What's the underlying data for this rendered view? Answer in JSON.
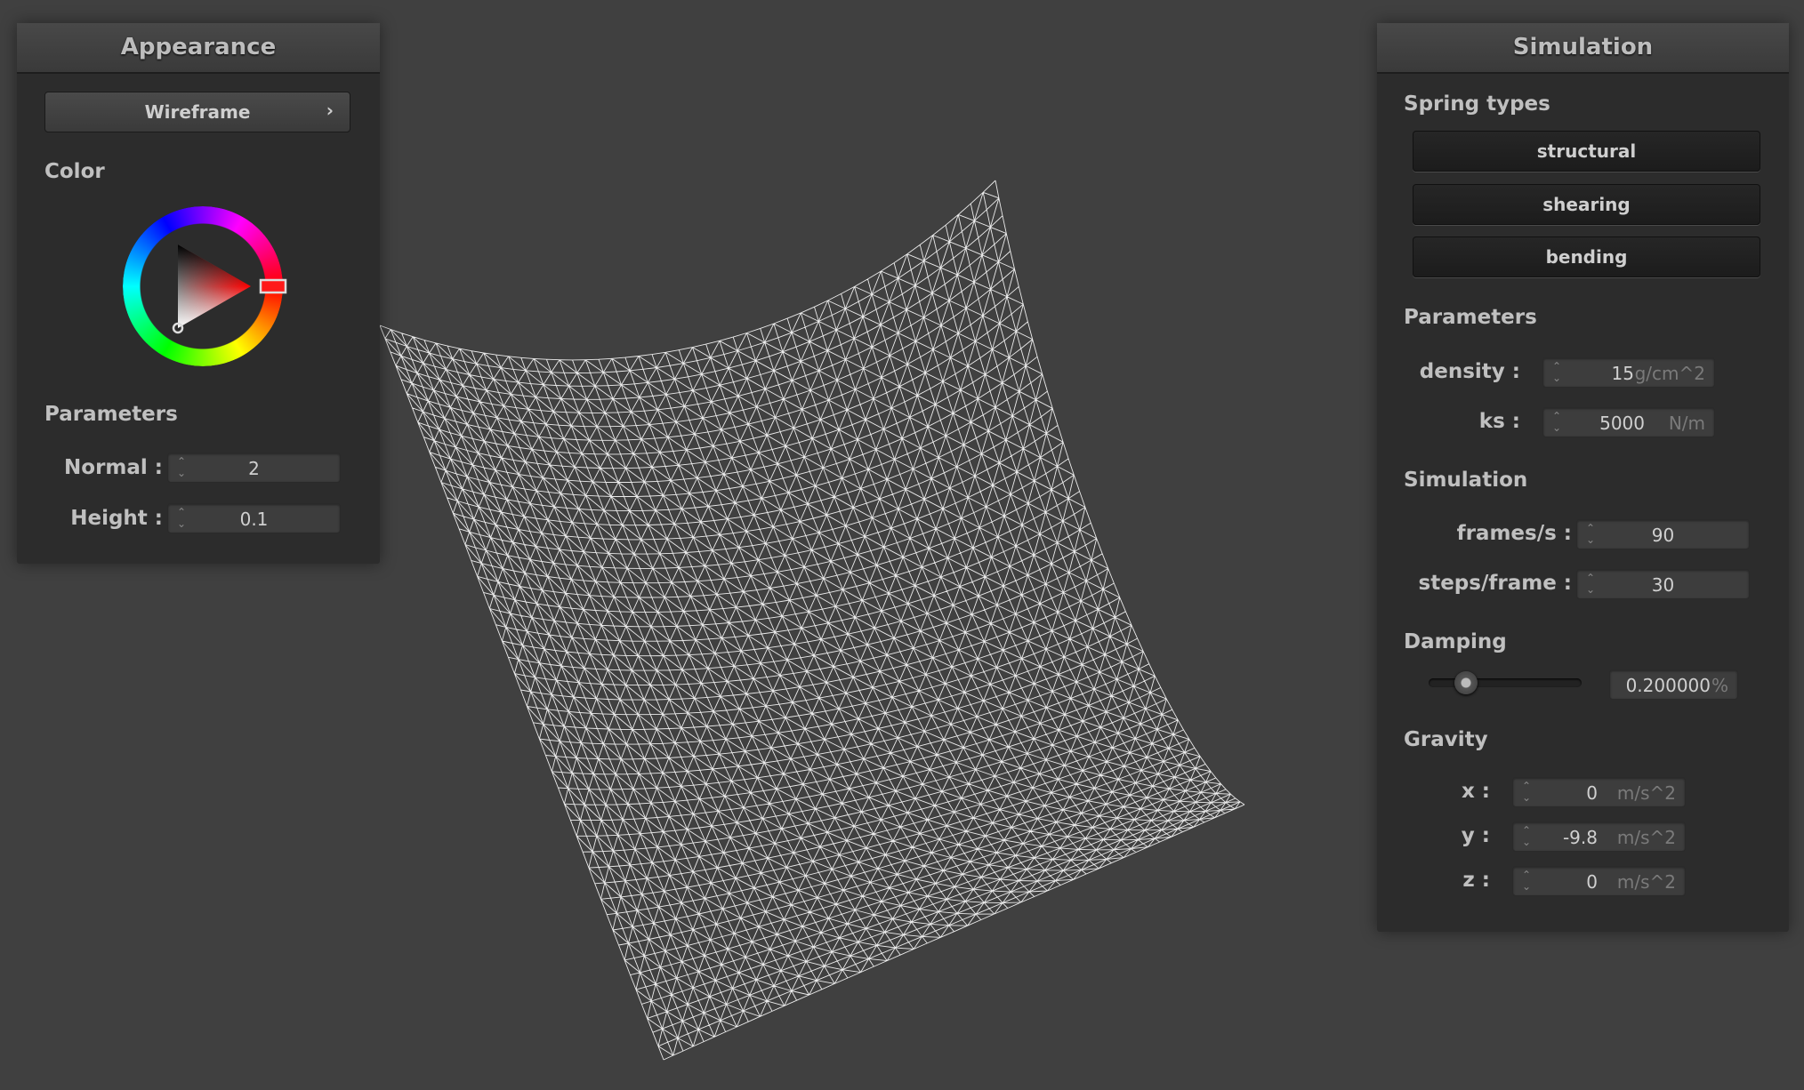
{
  "appearance": {
    "title": "Appearance",
    "mode_button": "Wireframe",
    "mode_chevron": "›",
    "color_label": "Color",
    "color": "#ff0000",
    "parameters_label": "Parameters",
    "normal_label": "Normal :",
    "normal_value": "2",
    "height_label": "Height :",
    "height_value": "0.1"
  },
  "simulation_panel": {
    "title": "Simulation",
    "spring_types_label": "Spring types",
    "spring_types": [
      "structural",
      "shearing",
      "bending"
    ],
    "parameters_label": "Parameters",
    "density_label": "density :",
    "density_value": "15",
    "density_unit": "g/cm^2",
    "ks_label": "ks :",
    "ks_value": "5000",
    "ks_unit": "N/m",
    "simulation_label": "Simulation",
    "fps_label": "frames/s :",
    "fps_value": "90",
    "steps_label": "steps/frame :",
    "steps_value": "30",
    "damping_label": "Damping",
    "damping_value": "0.200000",
    "damping_unit": "%",
    "damping_slider_fraction": 0.2,
    "gravity_label": "Gravity",
    "gravity": [
      {
        "label": "x :",
        "value": "0",
        "unit": "m/s^2"
      },
      {
        "label": "y :",
        "value": "-9.8",
        "unit": "m/s^2"
      },
      {
        "label": "z :",
        "value": "0",
        "unit": "m/s^2"
      }
    ]
  },
  "viewport": {
    "render_mode": "wireframe",
    "mesh_color": "#ffffff",
    "background": "#404040"
  }
}
